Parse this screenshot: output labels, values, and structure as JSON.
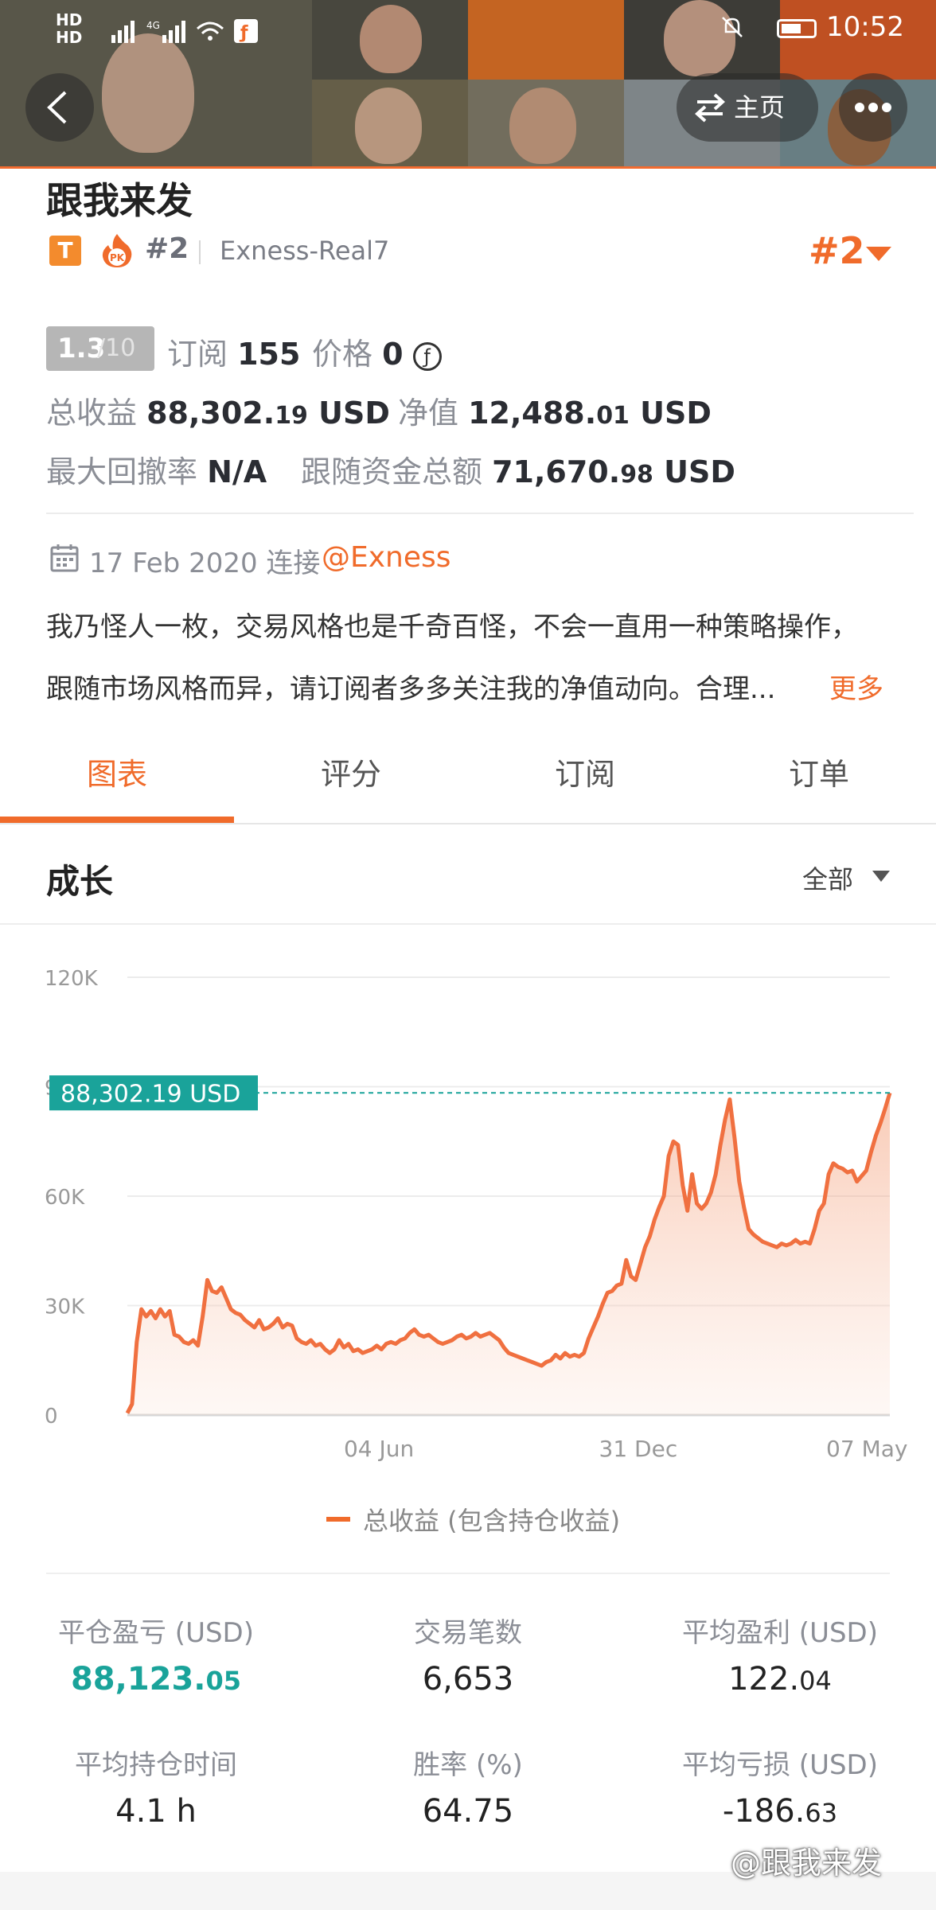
{
  "status_bar": {
    "network_labels": "HD\nHD",
    "network_type": "4G",
    "time": "10:52"
  },
  "header": {
    "back_icon": "chevron-left-icon",
    "home_label": "主页",
    "home_icon": "switch-icon",
    "more_icon": "more-dots-icon"
  },
  "profile": {
    "name": "跟我来发",
    "badge_t": "T",
    "badge_pk": "PK",
    "rank_small": "#2",
    "server": "Exness-Real7",
    "rank_big": "#2",
    "score_main": "1.3",
    "score_of": "/10",
    "subscribe_label": "订阅",
    "subscribe_value": "155",
    "price_label": "价格",
    "price_value": "0",
    "price_icon": "coin-icon",
    "total_profit_label": "总收益",
    "total_profit_int": "88,302.",
    "total_profit_dec": "19",
    "total_profit_unit": "USD",
    "equity_label": "净值",
    "equity_int": "12,488.",
    "equity_dec": "01",
    "equity_unit": "USD",
    "drawdown_label": "最大回撤率",
    "drawdown_value": "N/A",
    "follow_funds_label": "跟随资金总额",
    "follow_funds_int": "71,670.",
    "follow_funds_dec": "98",
    "follow_funds_unit": "USD",
    "date": "17 Feb 2020 连接",
    "broker": "@Exness",
    "desc_line1": "我乃怪人一枚，交易风格也是千奇百怪，不会一直用一种策略操作，",
    "desc_line2": "跟随市场风格而异，请订阅者多多关注我的净值动向。合理...",
    "more_label": "更多"
  },
  "tabs": [
    {
      "label": "图表",
      "active": true
    },
    {
      "label": "评分",
      "active": false
    },
    {
      "label": "订阅",
      "active": false
    },
    {
      "label": "订单",
      "active": false
    }
  ],
  "growth": {
    "title": "成长",
    "filter_label": "全部",
    "legend_label": "总收益 (包含持仓收益)"
  },
  "colors": {
    "accent": "#f06b2b",
    "tag_green": "#1aa39a",
    "line": "#f07040"
  },
  "chart_data": {
    "type": "area",
    "series_name": "总收益 (包含持仓收益)",
    "yticks": [
      "120K",
      "90K",
      "60K",
      "30K",
      "0"
    ],
    "ylim": [
      0,
      120000
    ],
    "xticks": [
      {
        "label": "04 Jun",
        "pos": 0.33
      },
      {
        "label": "31 Dec",
        "pos": 0.67
      },
      {
        "label": "07 May",
        "pos": 0.97
      }
    ],
    "current_value_label": "88,302.19 USD",
    "current_value": 88302.19,
    "values": [
      500,
      3000,
      20000,
      29000,
      27000,
      28500,
      26500,
      29000,
      27000,
      28500,
      22000,
      21500,
      20000,
      19500,
      20500,
      19000,
      27000,
      37000,
      34000,
      33500,
      35000,
      32000,
      29000,
      28000,
      27500,
      26000,
      25000,
      24000,
      26000,
      23500,
      24000,
      25000,
      26500,
      24000,
      25000,
      24500,
      21000,
      20000,
      19500,
      20500,
      19000,
      19500,
      18000,
      17000,
      18000,
      20500,
      18500,
      19500,
      17500,
      18000,
      17000,
      17500,
      18000,
      19000,
      18000,
      19500,
      20000,
      19500,
      20500,
      21000,
      22500,
      23500,
      22000,
      21500,
      22000,
      21000,
      20000,
      19500,
      20000,
      20500,
      21500,
      22000,
      21000,
      21500,
      22500,
      21500,
      22000,
      22500,
      21500,
      20500,
      18500,
      17000,
      16500,
      16000,
      15500,
      15000,
      14500,
      14000,
      13500,
      14500,
      15000,
      16500,
      15500,
      17000,
      16000,
      16500,
      16000,
      17000,
      21000,
      24000,
      27000,
      30500,
      33500,
      34000,
      35500,
      36000,
      42500,
      38000,
      37000,
      41500,
      46000,
      49000,
      53500,
      57000,
      60000,
      71000,
      75000,
      74000,
      63000,
      56000,
      66000,
      58000,
      56500,
      58000,
      61000,
      66000,
      74000,
      81000,
      86500,
      76000,
      64000,
      57000,
      51000,
      49500,
      48500,
      47500,
      47000,
      46500,
      46000,
      47000,
      46500,
      47000,
      48000,
      47000,
      47500,
      47000,
      51000,
      56000,
      58000,
      66000,
      69000,
      68000,
      67500,
      66500,
      67000,
      64000,
      65500,
      67000,
      72000,
      76500,
      80000,
      84000,
      88302
    ]
  },
  "stats": [
    {
      "label": "平仓盈亏 (USD)",
      "int": "88,123.",
      "dec": "05",
      "green": true
    },
    {
      "label": "交易笔数",
      "int": "6,653",
      "dec": "",
      "green": false
    },
    {
      "label": "平均盈利 (USD)",
      "int": "122.",
      "dec": "04",
      "green": false
    },
    {
      "label": "平均持仓时间",
      "int": "4.1 h",
      "dec": "",
      "green": false
    },
    {
      "label": "胜率 (%)",
      "int": "64.75",
      "dec": "",
      "green": false
    },
    {
      "label": "平均亏损 (USD)",
      "int": "-186.",
      "dec": "63",
      "green": false
    }
  ],
  "watermark": "@跟我来发"
}
